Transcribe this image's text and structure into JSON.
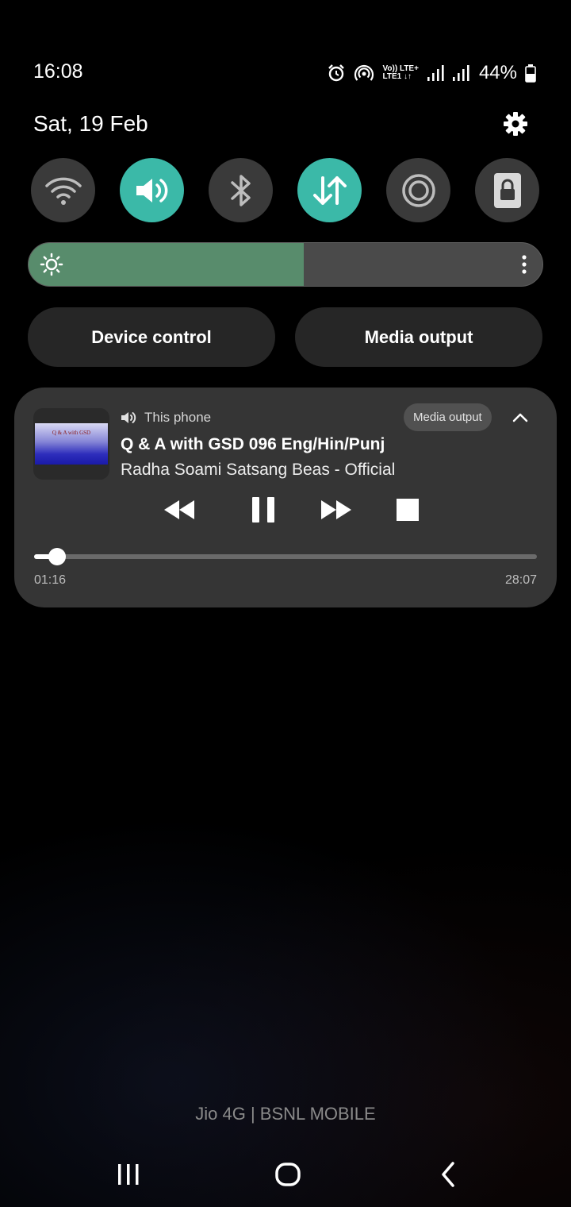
{
  "status_bar": {
    "time": "16:08",
    "volte_top": "Vo)) LTE+",
    "volte_bottom": "LTE1 ↓↑",
    "battery_percent": "44%",
    "icons": [
      "alarm-icon",
      "hotspot-icon",
      "volte-icon",
      "signal-icon",
      "signal-icon",
      "battery-icon"
    ]
  },
  "header": {
    "date": "Sat, 19 Feb",
    "settings_icon": "gear-icon"
  },
  "quick_tiles": [
    {
      "name": "wifi",
      "icon": "wifi-icon",
      "active": false
    },
    {
      "name": "sound",
      "icon": "speaker-icon",
      "active": true
    },
    {
      "name": "bluetooth",
      "icon": "bluetooth-icon",
      "active": false
    },
    {
      "name": "mobile-data",
      "icon": "data-arrows-icon",
      "active": true
    },
    {
      "name": "hotspot",
      "icon": "hotspot-icon",
      "active": false
    },
    {
      "name": "secure-folder",
      "icon": "lock-icon",
      "active": false
    }
  ],
  "brightness": {
    "level": 0.535,
    "icon": "sun-icon",
    "menu_icon": "more-vertical-icon"
  },
  "buttons": {
    "device_control": "Device control",
    "media_output": "Media output"
  },
  "media_player": {
    "album_art_title": "Q & A with GSD",
    "output_device": "This phone",
    "output_chip": "Media output",
    "title": "Q & A with GSD 096 Eng/Hin/Punj",
    "artist": "Radha Soami Satsang Beas - Official",
    "elapsed": "01:16",
    "duration": "28:07",
    "progress": 0.045
  },
  "carrier_text": "Jio 4G | BSNL MOBILE",
  "colors": {
    "accent": "#3bb9a8",
    "brightness_fill": "#588c6c",
    "card_bg": "#353535"
  }
}
